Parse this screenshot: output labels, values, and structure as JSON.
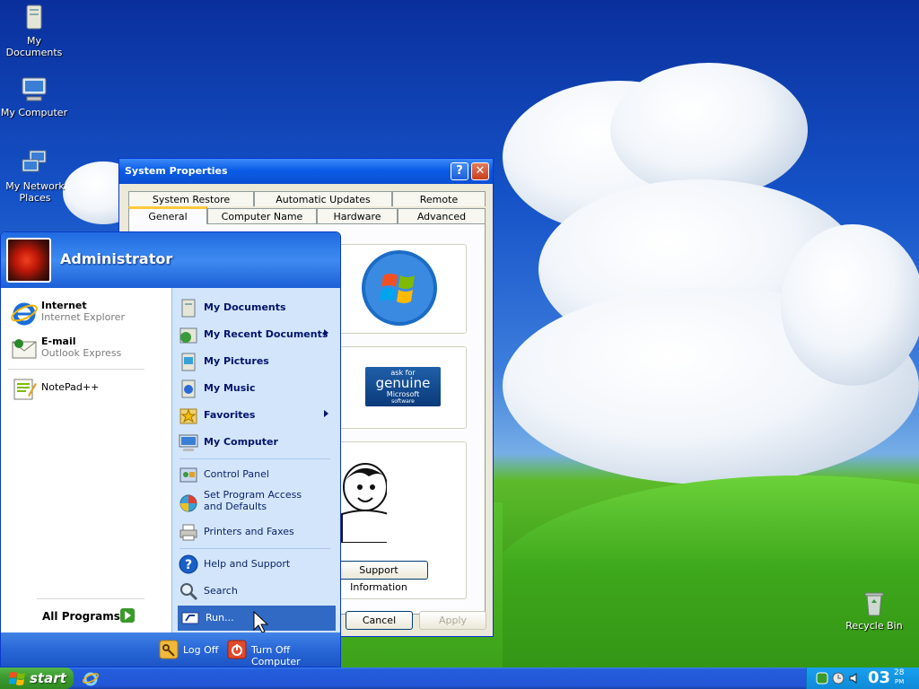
{
  "desktop": {
    "icons": [
      {
        "label": "My Documents"
      },
      {
        "label": "My Computer"
      },
      {
        "label": "My Network Places"
      },
      {
        "label": "Recycle Bin"
      }
    ]
  },
  "system_properties": {
    "title": "System Properties",
    "tabs_top": [
      "System Restore",
      "Automatic Updates",
      "Remote"
    ],
    "tabs_bottom": [
      "General",
      "Computer Name",
      "Hardware",
      "Advanced"
    ],
    "genuine_badge": {
      "line1": "ask for",
      "line2": "genuine",
      "line3": "Microsoft",
      "line4": "software"
    },
    "support_button": "Support Information",
    "cancel_button": "Cancel",
    "apply_button": "Apply"
  },
  "start_menu": {
    "user_name": "Administrator",
    "pinned": [
      {
        "title": "Internet",
        "subtitle": "Internet Explorer"
      },
      {
        "title": "E-mail",
        "subtitle": "Outlook Express"
      }
    ],
    "recent": [
      {
        "title": "NotePad++"
      }
    ],
    "all_programs": "All Programs",
    "right_items": [
      {
        "label": "My Documents"
      },
      {
        "label": "My Recent Documents"
      },
      {
        "label": "My Pictures"
      },
      {
        "label": "My Music"
      },
      {
        "label": "Favorites"
      },
      {
        "label": "My Computer"
      },
      {
        "label": "Control Panel"
      },
      {
        "label": "Set Program Access and Defaults"
      },
      {
        "label": "Printers and Faxes"
      },
      {
        "label": "Help and Support"
      },
      {
        "label": "Search"
      },
      {
        "label": "Run..."
      }
    ],
    "log_off": "Log Off",
    "turn_off": "Turn Off Computer"
  },
  "taskbar": {
    "start_label": "start",
    "clock_time": "03",
    "clock_minutes": "28",
    "clock_ampm": "PM"
  },
  "colors": {
    "accent": "#245edb",
    "start_green": "#3c9a2f",
    "selection": "#316ac5"
  }
}
